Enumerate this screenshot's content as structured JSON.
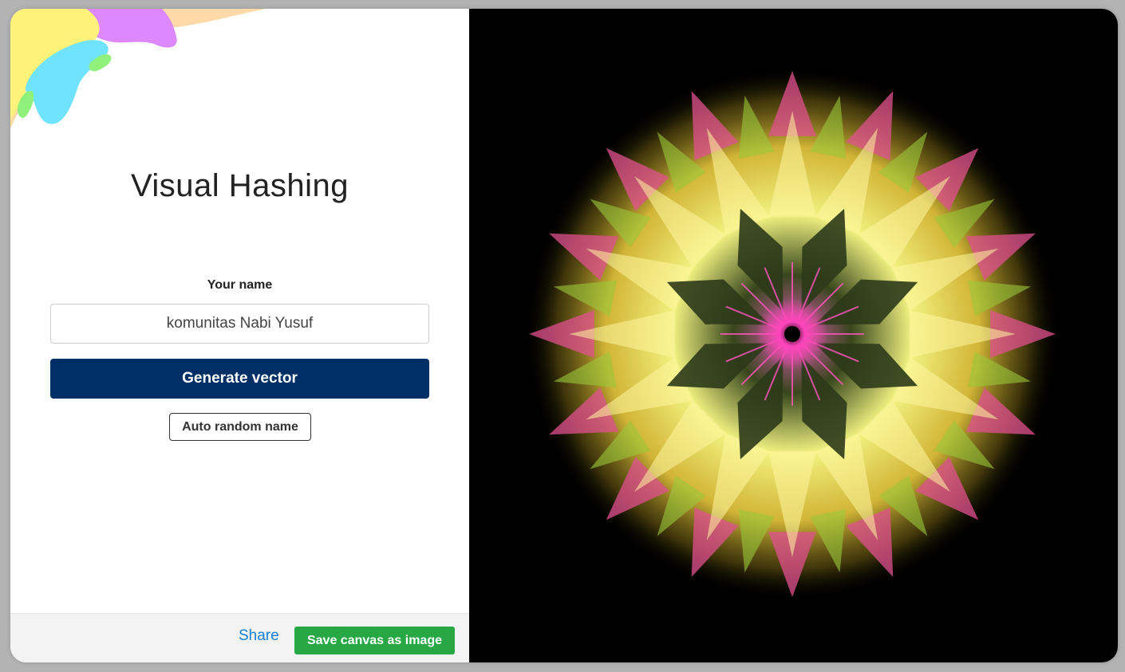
{
  "header": {
    "title": "Visual Hashing"
  },
  "form": {
    "name_label": "Your name",
    "name_value": "komunitas Nabi Yusuf",
    "generate_label": "Generate vector",
    "random_label": "Auto random name"
  },
  "footer": {
    "share_label": "Share",
    "save_label": "Save canvas as image"
  },
  "colors": {
    "primary": "#002f66",
    "success": "#28a745",
    "link": "#1a7fd4",
    "canvas_bg": "#000000",
    "blob_yellow": "#fff27a",
    "blob_purple": "#dd88ff",
    "blob_peach": "#ffd9a8",
    "blob_cyan": "#6fe3ff",
    "blob_green": "#8ff07a"
  },
  "icons": {
    "blob": "decorative-blob-shape",
    "pattern": "mandala-pattern"
  }
}
